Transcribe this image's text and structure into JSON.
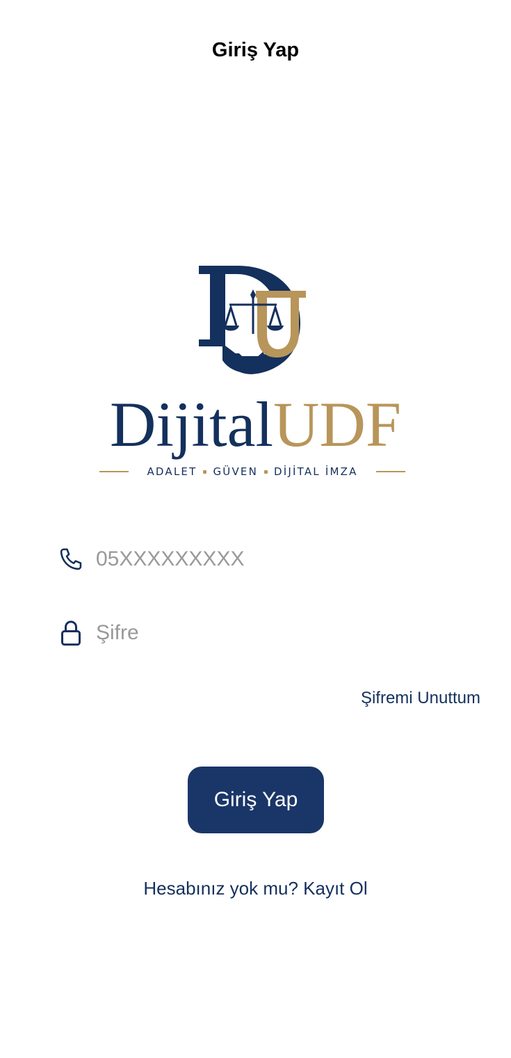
{
  "header": {
    "title": "Giriş Yap"
  },
  "logo": {
    "word_primary": "Dijital",
    "word_accent": "UDF",
    "tagline_1": "ADALET",
    "tagline_2": "GÜVEN",
    "tagline_3": "DİJİTAL İMZA",
    "icon": "scales-of-justice-monogram-icon"
  },
  "form": {
    "phone": {
      "icon": "phone-icon",
      "placeholder": "05XXXXXXXXX",
      "value": ""
    },
    "password": {
      "icon": "lock-icon",
      "placeholder": "Şifre",
      "value": ""
    },
    "forgot_label": "Şifremi Unuttum",
    "submit_label": "Giriş Yap",
    "signup_label": "Hesabınız yok mu? Kayıt Ol"
  },
  "colors": {
    "navy": "#14305c",
    "gold": "#b8955a",
    "button": "#1a3668"
  }
}
